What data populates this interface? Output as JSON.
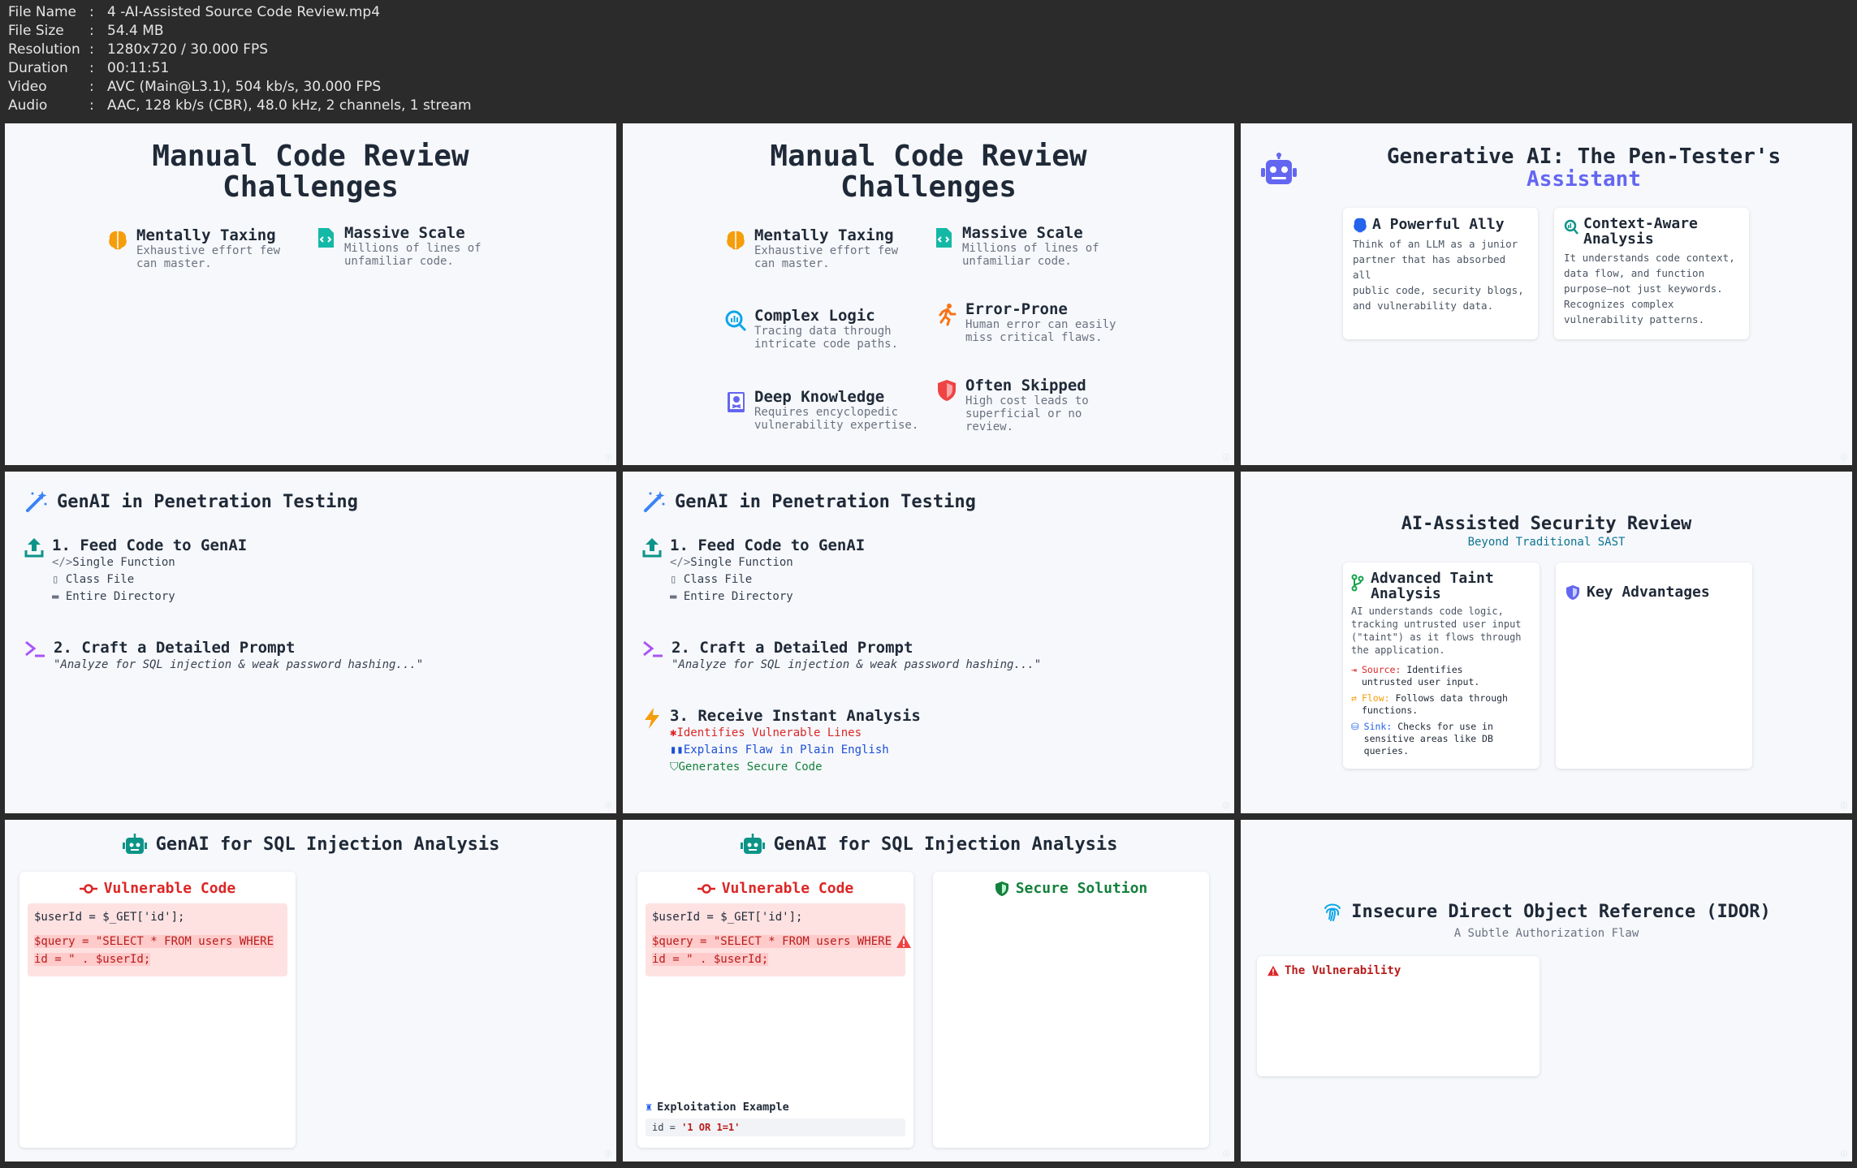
{
  "file_info": [
    {
      "key": "File Name",
      "value": "4 -AI-Assisted Source Code Review.mp4"
    },
    {
      "key": "File Size",
      "value": "54.4 MB"
    },
    {
      "key": "Resolution",
      "value": "1280x720 / 30.000 FPS"
    },
    {
      "key": "Duration",
      "value": "00:11:51"
    },
    {
      "key": "Video",
      "value": "AVC (Main@L3.1), 504 kb/s, 30.000 FPS"
    },
    {
      "key": "Audio",
      "value": "AAC, 128 kb/s (CBR), 48.0 kHz, 2 channels, 1 stream"
    }
  ],
  "separator": ":",
  "challenges": {
    "title_line1": "Manual Code Review",
    "title_line2": "Challenges",
    "items": [
      {
        "title": "Mentally Taxing",
        "desc1": "Exhaustive effort few",
        "desc2": "can master.",
        "desc3": ""
      },
      {
        "title": "Massive Scale",
        "desc1": "Millions of lines of",
        "desc2": "unfamiliar code.",
        "desc3": ""
      },
      {
        "title": "Complex Logic",
        "desc1": "Tracing data through",
        "desc2": "intricate code paths.",
        "desc3": ""
      },
      {
        "title": "Error-Prone",
        "desc1": "Human error can easily",
        "desc2": "miss critical flaws.",
        "desc3": ""
      },
      {
        "title": "Deep Knowledge",
        "desc1": "Requires encyclopedic",
        "desc2": "vulnerability expertise.",
        "desc3": ""
      },
      {
        "title": "Often Skipped",
        "desc1": "High cost leads to",
        "desc2": "superficial or no",
        "desc3": "review."
      }
    ]
  },
  "assistant": {
    "title_line1": "Generative AI: The Pen-Tester's",
    "title_line2": "Assistant",
    "cards": [
      {
        "title": "A Powerful Ally",
        "lines": [
          "Think of an LLM as a junior",
          "partner that has absorbed all",
          "public code, security blogs,",
          "and vulnerability data."
        ]
      },
      {
        "title_line1": "Context-Aware",
        "title_line2": "Analysis",
        "lines": [
          "It understands code context,",
          "data flow, and function",
          "purpose—not just keywords.",
          "Recognizes complex",
          "vulnerability patterns."
        ]
      }
    ]
  },
  "pentest": {
    "title": "GenAI in Penetration Testing",
    "step1": {
      "title": "1. Feed Code to GenAI",
      "subs": [
        "Single Function",
        "Class File",
        "Entire Directory"
      ]
    },
    "step2": {
      "title": "2. Craft a Detailed Prompt",
      "quote": "\"Analyze for SQL injection & weak password hashing...\""
    },
    "step3": {
      "title": "3. Receive Instant Analysis",
      "subs": [
        "Identifies Vulnerable Lines",
        "Explains Flaw in Plain English",
        "Generates Secure Code"
      ]
    }
  },
  "review": {
    "title": "AI-Assisted Security Review",
    "subtitle": "Beyond Traditional SAST",
    "taint": {
      "title_line1": "Advanced Taint",
      "title_line2": "Analysis",
      "lines": [
        "AI understands code logic,",
        "tracking untrusted user input",
        "(\"taint\") as it flows through",
        "the application."
      ],
      "source_label": "Source:",
      "source_text1": "Identifies",
      "source_text2": "untrusted user input.",
      "flow_label": "Flow:",
      "flow_text1": "Follows data through",
      "flow_text2": "functions.",
      "sink_label": "Sink:",
      "sink_text1": "Checks for use in",
      "sink_text2": "sensitive areas like DB",
      "sink_text3": "queries."
    },
    "advantages_title": "Key Advantages"
  },
  "sqli": {
    "title": "GenAI for SQL Injection Analysis",
    "vuln_title": "Vulnerable Code",
    "code_line1": "$userId = $_GET['id'];",
    "code_line2": "$query = \"SELECT * FROM users WHERE",
    "code_line3": "id = \" . $userId;",
    "secure_title": "Secure Solution",
    "exploit_title": "Exploitation Example",
    "exploit_prefix": "id = ",
    "exploit_value": "'1 OR 1=1'"
  },
  "idor": {
    "title": "Insecure Direct Object Reference (IDOR)",
    "subtitle": "A Subtle Authorization Flaw",
    "vuln_label": "The Vulnerability"
  },
  "colors": {
    "accent": "#6366f1",
    "teal": "#0d9488",
    "red": "#dc2626",
    "green": "#15803d",
    "orange": "#f59e0b"
  }
}
